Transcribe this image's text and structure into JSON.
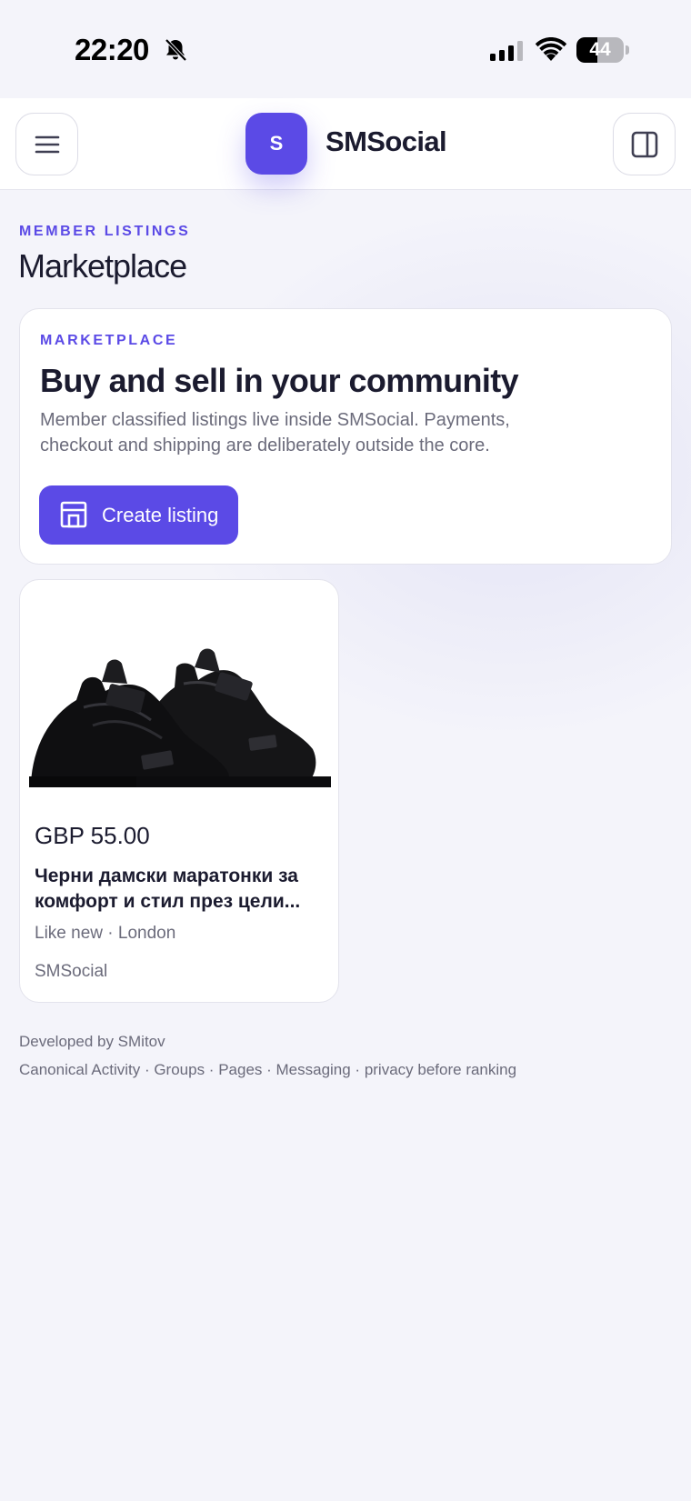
{
  "status_bar": {
    "time": "22:20",
    "silent_icon": "bell-slash-icon",
    "signal_icon": "cellular-signal-icon",
    "wifi_icon": "wifi-icon",
    "battery_level": "44",
    "battery_fraction": 0.44
  },
  "header": {
    "menu_icon": "hamburger-menu-icon",
    "logo_letter": "S",
    "brand_name": "SMSocial",
    "panel_icon": "sidebar-panel-icon"
  },
  "page": {
    "eyebrow": "MEMBER LISTINGS",
    "title": "Marketplace"
  },
  "hero": {
    "eyebrow": "MARKETPLACE",
    "title": "Buy and sell in your community",
    "description": "Member classified listings live inside SMSocial. Payments, checkout and shipping are deliberately outside the core.",
    "button_icon": "storefront-icon",
    "button_label": "Create listing"
  },
  "listings": [
    {
      "image": "black-sneakers-photo",
      "price": "GBP 55.00",
      "title": "Черни дамски маратонки за комфорт и стил през цели...",
      "meta": "Like new · London",
      "seller": "SMSocial"
    }
  ],
  "footer": {
    "developed_by": "Developed by SMitov",
    "links": "Canonical Activity · Groups · Pages · Messaging · privacy before ranking"
  },
  "colors": {
    "accent": "#5b4ae6",
    "background": "#f4f4fa",
    "text": "#1b1b2f",
    "muted": "#6b6b7b"
  }
}
